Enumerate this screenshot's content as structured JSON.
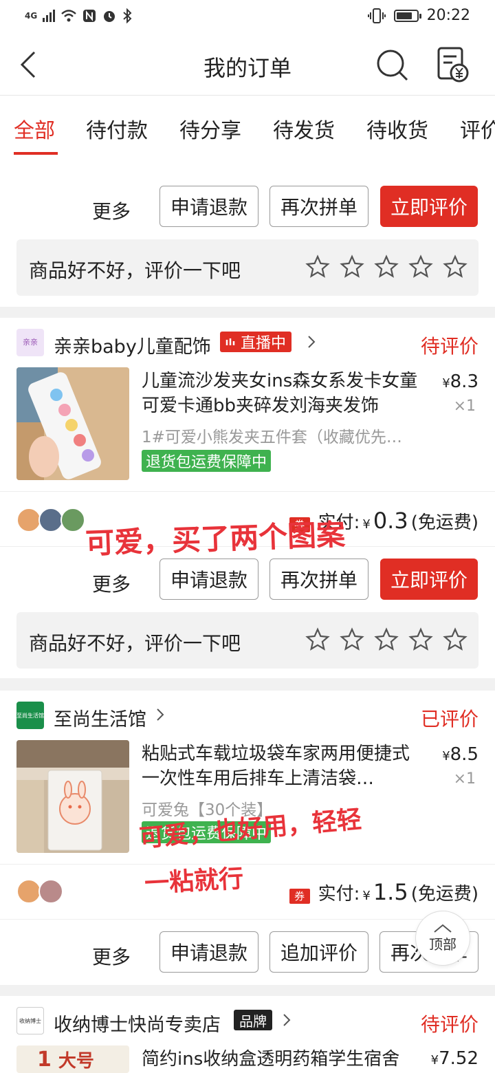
{
  "status_bar": {
    "network": "4G",
    "time": "20:22"
  },
  "header": {
    "title": "我的订单"
  },
  "tabs": [
    "全部",
    "待付款",
    "待分享",
    "待发货",
    "待收货",
    "评价"
  ],
  "common": {
    "more": "更多",
    "refund": "申请退款",
    "rebuy": "再次拼单",
    "review_now": "立即评价",
    "add_review": "追加评价",
    "review_prompt": "商品好不好，评价一下吧",
    "paid_label": "实付:",
    "yen": "¥",
    "free_shipping": "(免运费)",
    "guarantee": "退货包运费保障中",
    "coupon": "券"
  },
  "orders": [
    {
      "shop": "亲亲baby儿童配饰",
      "logo_text": "亲亲",
      "badge": "直播中",
      "status": "待评价",
      "title": "儿童流沙发夹女ins森女系发卡女童可爱卡通bb夹碎发刘海夹发饰",
      "price": "8.3",
      "qty": "×1",
      "spec": "1#可爱小熊发夹五件套（收藏优先…",
      "paid": "0.3"
    },
    {
      "shop": "至尚生活馆",
      "logo_text": "至尚生活馆",
      "status": "已评价",
      "title": "粘贴式车载垃圾袋车家两用便捷式一次性车用后排车上清洁袋…",
      "price": "8.5",
      "qty": "×1",
      "spec": "可爱兔【30个装】",
      "paid": "1.5"
    },
    {
      "shop": "收纳博士快尚专卖店",
      "logo_text": "收纳博士",
      "badge": "品牌",
      "status": "待评价",
      "title": "简约ins收纳盒透明药箱学生宿舍",
      "price": "7.52",
      "thumb_text": "大号",
      "thumb_num": "1"
    }
  ],
  "annotations": {
    "note1": "可爱，买了两个图案",
    "note2_line1": "可爱，也好用，轻轻",
    "note2_line2": "一粘就行"
  },
  "back_to_top": "顶部",
  "colors": {
    "accent": "#e02e24",
    "guarantee": "#3fb24f",
    "handwriting": "#e8333a"
  },
  "icons": [
    "back-arrow-icon",
    "search-icon",
    "receipt-yen-icon",
    "star-icon",
    "chevron-right-icon",
    "live-bars-icon",
    "back-to-top-icon"
  ]
}
